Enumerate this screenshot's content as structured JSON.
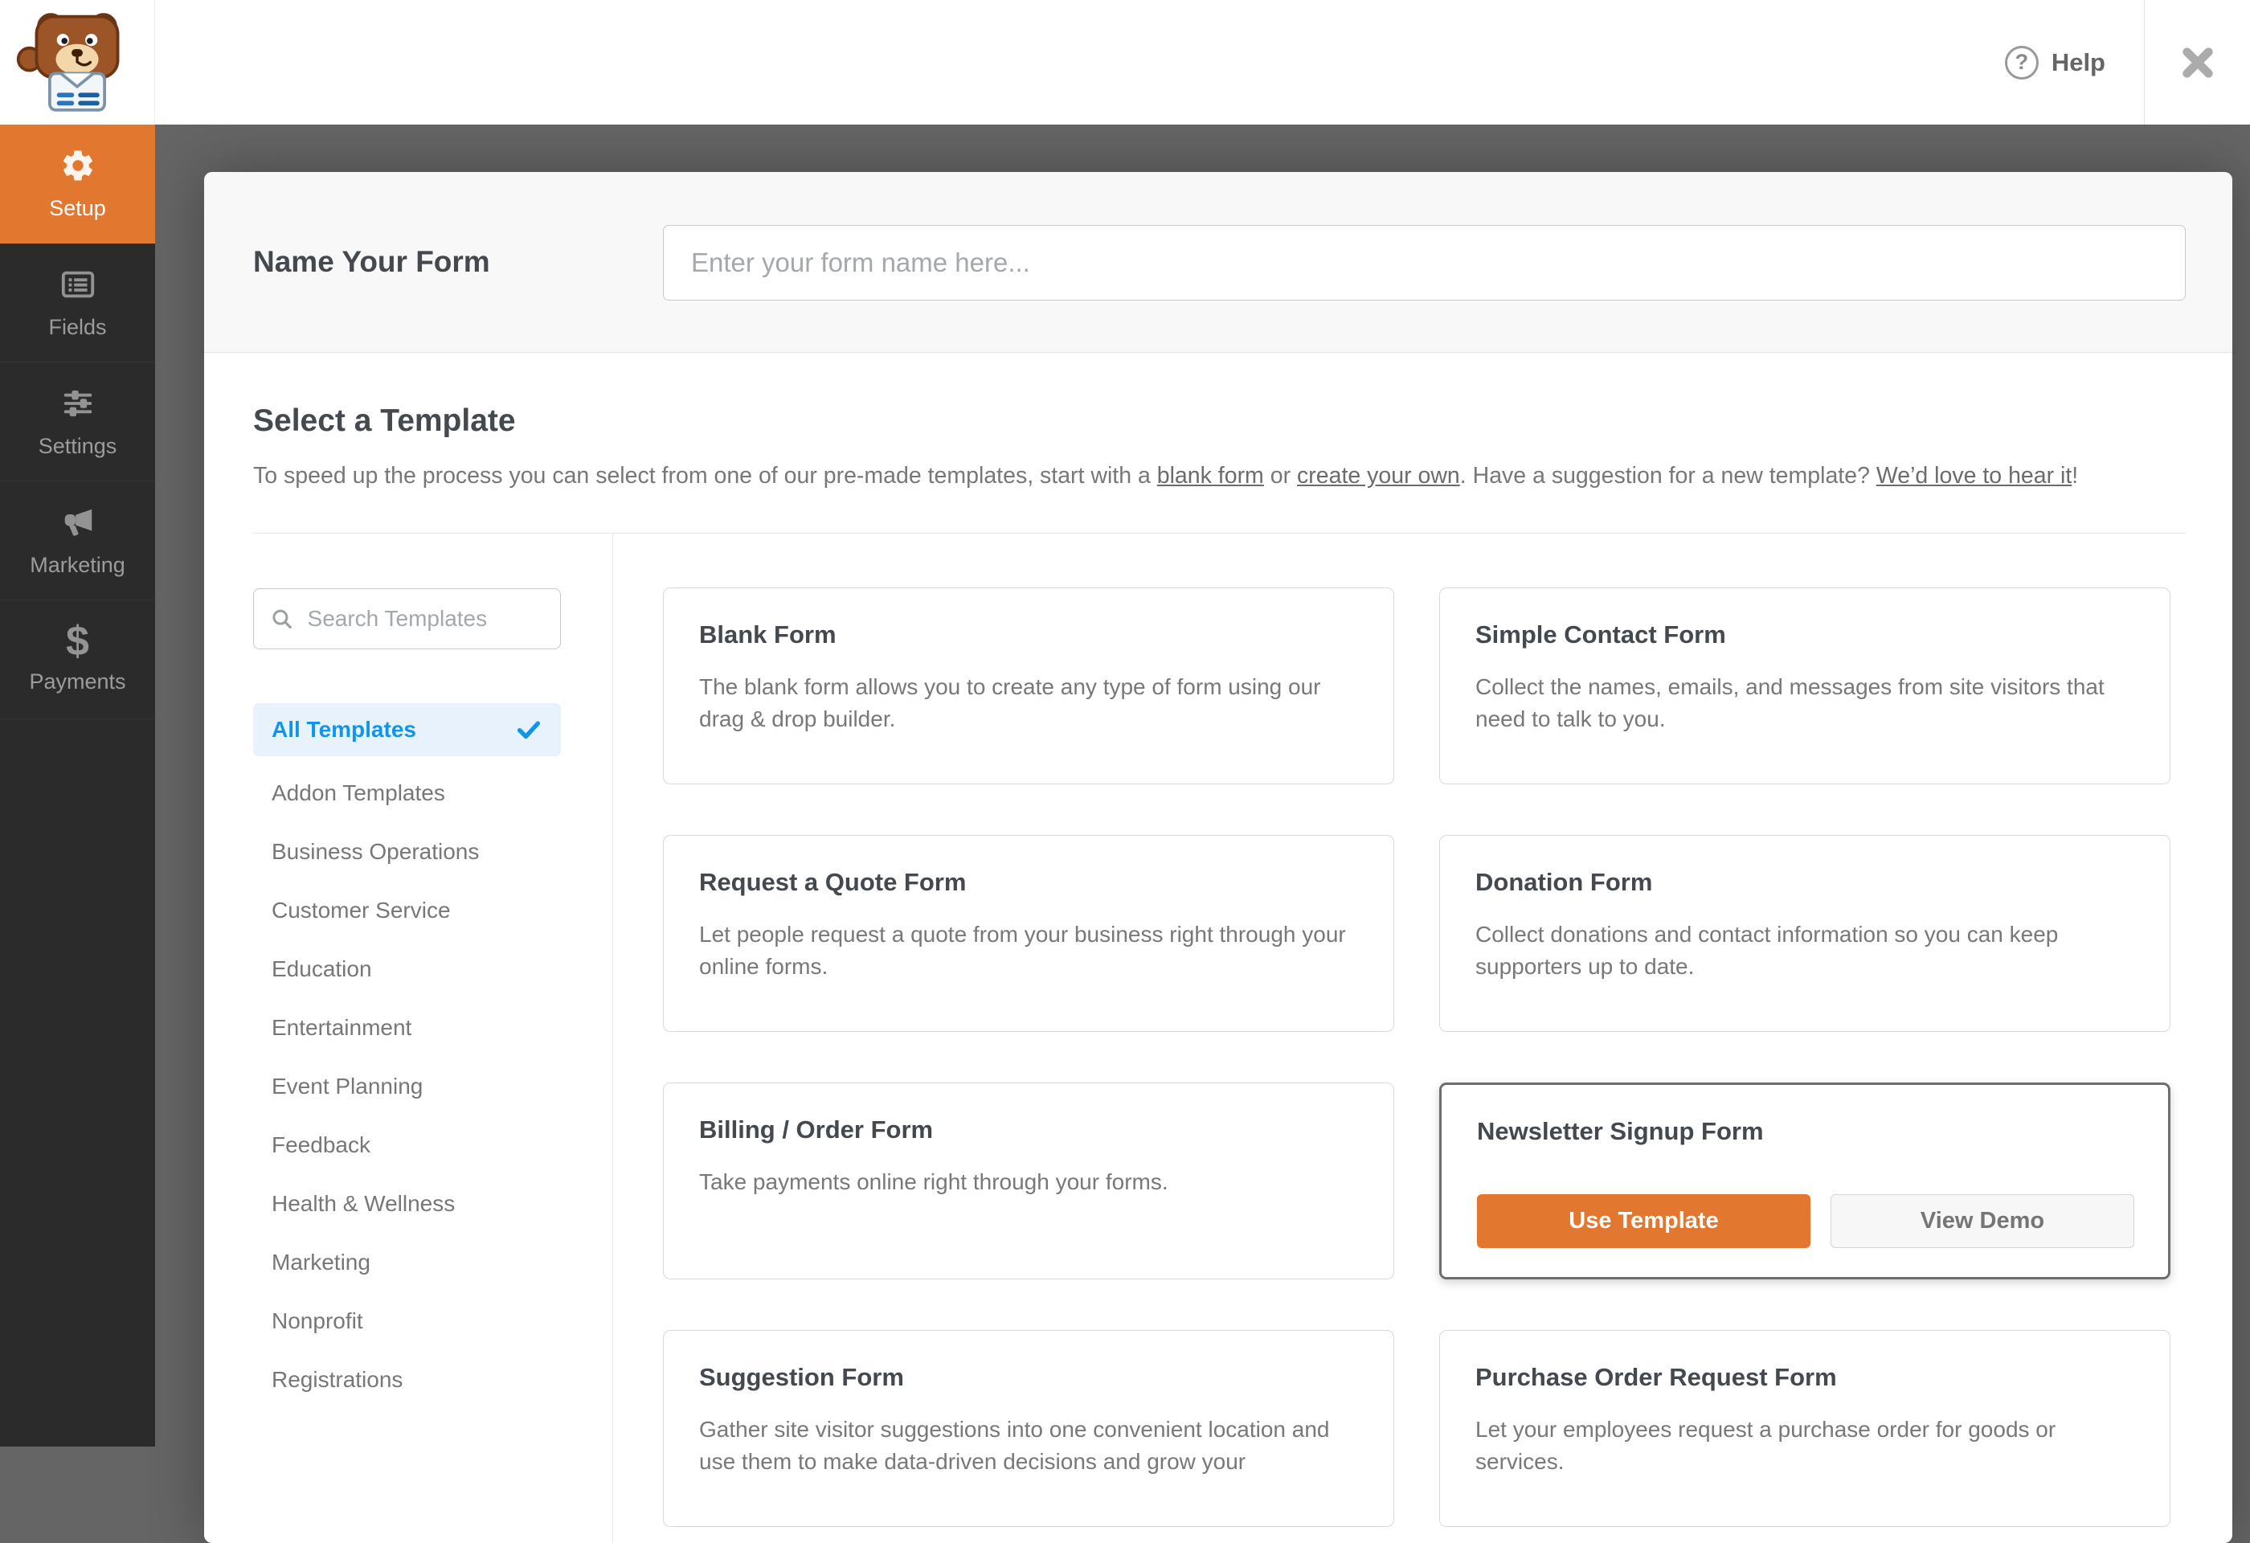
{
  "colors": {
    "accent_orange": "#e27730",
    "link_blue": "#1095e8",
    "selected_category_bg": "#e8f2fd",
    "sidebar_bg": "#2b2b2b",
    "backdrop": "#666565"
  },
  "header": {
    "help_label": "Help"
  },
  "sidebar": {
    "items": [
      {
        "label": "Setup",
        "icon": "gear-icon",
        "active": true
      },
      {
        "label": "Fields",
        "icon": "form-fields-icon",
        "active": false
      },
      {
        "label": "Settings",
        "icon": "sliders-icon",
        "active": false
      },
      {
        "label": "Marketing",
        "icon": "megaphone-icon",
        "active": false
      },
      {
        "label": "Payments",
        "icon": "dollar-icon",
        "active": false
      }
    ]
  },
  "modal": {
    "name_section": {
      "label": "Name Your Form",
      "placeholder": "Enter your form name here..."
    },
    "select_section": {
      "title": "Select a Template",
      "intro_prefix": "To speed up the process you can select from one of our pre-made templates, start with a ",
      "link_blank": "blank form",
      "intro_mid1": " or ",
      "link_create": "create your own",
      "intro_mid2": ". Have a suggestion for a new template? ",
      "link_suggest": "We’d love to hear it",
      "intro_suffix": "!"
    },
    "search": {
      "placeholder": "Search Templates"
    },
    "categories": [
      {
        "label": "All Templates",
        "selected": true
      },
      {
        "label": "Addon Templates",
        "selected": false
      },
      {
        "label": "Business Operations",
        "selected": false
      },
      {
        "label": "Customer Service",
        "selected": false
      },
      {
        "label": "Education",
        "selected": false
      },
      {
        "label": "Entertainment",
        "selected": false
      },
      {
        "label": "Event Planning",
        "selected": false
      },
      {
        "label": "Feedback",
        "selected": false
      },
      {
        "label": "Health & Wellness",
        "selected": false
      },
      {
        "label": "Marketing",
        "selected": false
      },
      {
        "label": "Nonprofit",
        "selected": false
      },
      {
        "label": "Registrations",
        "selected": false
      }
    ],
    "cards": [
      {
        "title": "Blank Form",
        "description": "The blank form allows you to create any type of form using our drag & drop builder."
      },
      {
        "title": "Simple Contact Form",
        "description": "Collect the names, emails, and messages from site visitors that need to talk to you."
      },
      {
        "title": "Request a Quote Form",
        "description": "Let people request a quote from your business right through your online forms."
      },
      {
        "title": "Donation Form",
        "description": "Collect donations and contact information so you can keep supporters up to date."
      },
      {
        "title": "Billing / Order Form",
        "description": "Take payments online right through your forms."
      },
      {
        "title": "Newsletter Signup Form",
        "hovered": true,
        "use_template_label": "Use Template",
        "view_demo_label": "View Demo"
      },
      {
        "title": "Suggestion Form",
        "description": "Gather site visitor suggestions into one convenient location and use them to make data-driven decisions and grow your"
      },
      {
        "title": "Purchase Order Request Form",
        "description": "Let your employees request a purchase order for goods or services."
      }
    ]
  }
}
